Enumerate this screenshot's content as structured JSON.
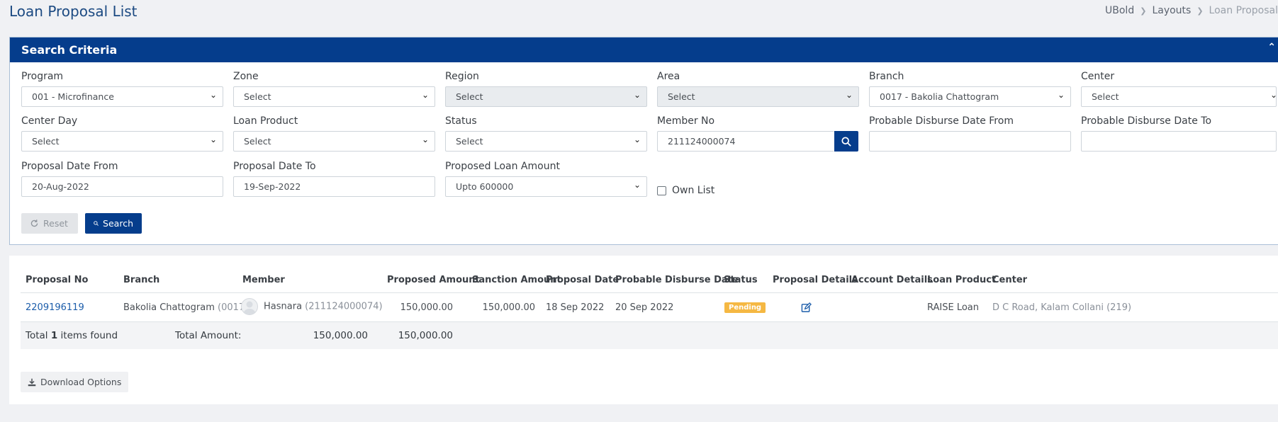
{
  "page": {
    "title": "Loan Proposal List"
  },
  "breadcrumb": [
    "UBold",
    "Layouts",
    "Loan Proposal"
  ],
  "search": {
    "title": "Search Criteria",
    "fields": {
      "program": {
        "label": "Program",
        "value": "001 - Microfinance"
      },
      "zone": {
        "label": "Zone",
        "value": "Select"
      },
      "region": {
        "label": "Region",
        "value": "Select"
      },
      "area": {
        "label": "Area",
        "value": "Select"
      },
      "branch": {
        "label": "Branch",
        "value": "0017 - Bakolia Chattogram"
      },
      "center": {
        "label": "Center",
        "value": "Select"
      },
      "center_day": {
        "label": "Center Day",
        "value": "Select"
      },
      "loan_product": {
        "label": "Loan Product",
        "value": "Select"
      },
      "status": {
        "label": "Status",
        "value": "Select"
      },
      "member_no": {
        "label": "Member No",
        "value": "211124000074"
      },
      "disburse_from": {
        "label": "Probable Disburse Date From",
        "value": ""
      },
      "disburse_to": {
        "label": "Probable Disburse Date To",
        "value": ""
      },
      "proposal_from": {
        "label": "Proposal Date From",
        "value": "20-Aug-2022"
      },
      "proposal_to": {
        "label": "Proposal Date To",
        "value": "19-Sep-2022"
      },
      "loan_amount": {
        "label": "Proposed Loan Amount",
        "value": "Upto 600000"
      }
    },
    "own_list_label": "Own List",
    "reset_label": "Reset",
    "search_label": "Search"
  },
  "table": {
    "headers": [
      "Proposal No",
      "Branch",
      "Member",
      "Proposed Amount",
      "Sanction Amount",
      "Proposal Date",
      "Probable Disburse Date",
      "Status",
      "Proposal Details",
      "Account Details",
      "Loan Product",
      "Center"
    ],
    "rows": [
      {
        "proposal_no": "2209196119",
        "branch": "Bakolia Chattogram",
        "branch_code": "(0017)",
        "member": "Hasnara",
        "member_no": "(211124000074)",
        "proposed_amount": "150,000.00",
        "sanction_amount": "150,000.00",
        "proposal_date": "18 Sep 2022",
        "disburse_date": "20 Sep 2022",
        "status": "Pending",
        "loan_product": "RAISE Loan",
        "center": "D C Road, Kalam Collani (219)"
      }
    ],
    "footer": {
      "total_prefix": "Total",
      "total_count": "1",
      "total_suffix": "items found",
      "total_amount_label": "Total Amount:",
      "total_proposed": "150,000.00",
      "total_sanction": "150,000.00"
    }
  },
  "download_label": "Download Options",
  "colors": {
    "primary": "#053d8c",
    "badge_pending": "#f5b843",
    "link": "#1c5daa"
  }
}
